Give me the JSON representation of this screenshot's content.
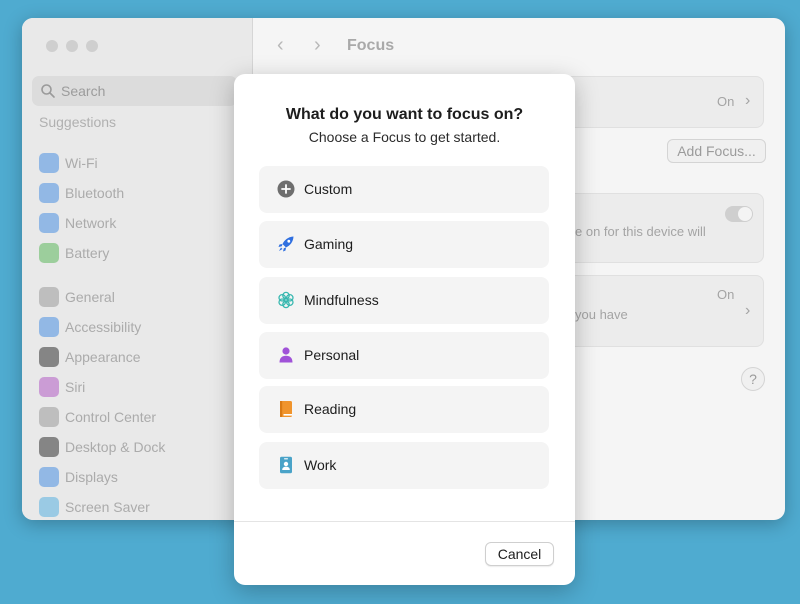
{
  "window": {
    "title": "Focus",
    "search_placeholder": "Search",
    "sidebar_heading": "Suggestions",
    "sidebar_items": [
      {
        "label": "Wi-Fi",
        "icon": "wifi-icon",
        "color": "#4a90e2"
      },
      {
        "label": "Bluetooth",
        "icon": "bluetooth-icon",
        "color": "#4a90e2"
      },
      {
        "label": "Network",
        "icon": "network-icon",
        "color": "#4a90e2"
      },
      {
        "label": "Battery",
        "icon": "battery-icon",
        "color": "#5cb85c"
      },
      {
        "label": "General",
        "icon": "gear-icon",
        "color": "#9a9a9a"
      },
      {
        "label": "Accessibility",
        "icon": "accessibility-icon",
        "color": "#4a90e2"
      },
      {
        "label": "Appearance",
        "icon": "appearance-icon",
        "color": "#333333"
      },
      {
        "label": "Siri",
        "icon": "siri-icon",
        "color": "#b25cc4"
      },
      {
        "label": "Control Center",
        "icon": "control-center-icon",
        "color": "#9a9a9a"
      },
      {
        "label": "Desktop & Dock",
        "icon": "desktop-dock-icon",
        "color": "#333333"
      },
      {
        "label": "Displays",
        "icon": "displays-icon",
        "color": "#4a90e2"
      },
      {
        "label": "Screen Saver",
        "icon": "screen-saver-icon",
        "color": "#5ab0e0"
      }
    ],
    "main": {
      "row1_value": "On",
      "add_focus_label": "Add Focus...",
      "share_text": "e on for this device will",
      "row3_text": "you have",
      "row3_value": "On",
      "help_label": "?"
    }
  },
  "dialog": {
    "title": "What do you want to focus on?",
    "subtitle": "Choose a Focus to get started.",
    "options": [
      {
        "label": "Custom",
        "icon": "plus-circle-icon",
        "color": "#6e6e6e"
      },
      {
        "label": "Gaming",
        "icon": "rocket-icon",
        "color": "#2f6fe0"
      },
      {
        "label": "Mindfulness",
        "icon": "flower-icon",
        "color": "#39b8b0"
      },
      {
        "label": "Personal",
        "icon": "person-icon",
        "color": "#a052d8"
      },
      {
        "label": "Reading",
        "icon": "book-icon",
        "color": "#f0942c"
      },
      {
        "label": "Work",
        "icon": "id-badge-icon",
        "color": "#4aa3c8"
      }
    ],
    "cancel_label": "Cancel"
  }
}
